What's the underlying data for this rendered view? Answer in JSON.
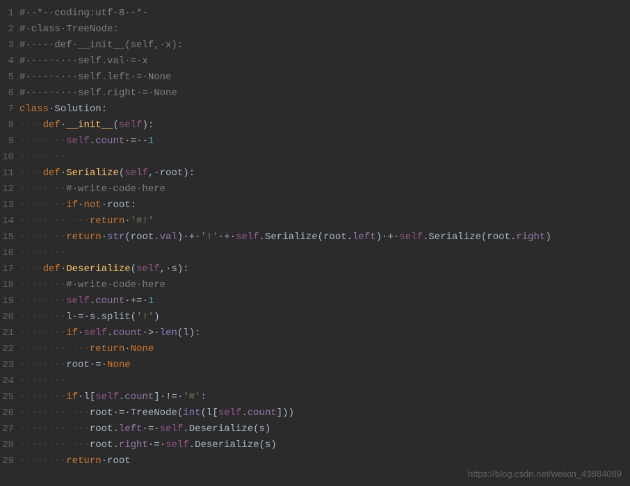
{
  "lines": [
    {
      "n": "1",
      "tokens": [
        [
          "comment",
          "#·-*-·coding:utf-8·-*-"
        ]
      ]
    },
    {
      "n": "2",
      "tokens": [
        [
          "comment",
          "#·class·TreeNode:"
        ]
      ]
    },
    {
      "n": "3",
      "tokens": [
        [
          "comment",
          "#·····def·__init__(self,·x):"
        ]
      ]
    },
    {
      "n": "4",
      "tokens": [
        [
          "comment",
          "#·········self.val·=·x"
        ]
      ]
    },
    {
      "n": "5",
      "tokens": [
        [
          "comment",
          "#·········self.left·=·None"
        ]
      ]
    },
    {
      "n": "6",
      "tokens": [
        [
          "comment",
          "#·········self.right·=·None"
        ]
      ]
    },
    {
      "n": "7",
      "tokens": [
        [
          "keyword",
          "class"
        ],
        [
          "default",
          "·"
        ],
        [
          "classname",
          "Solution"
        ],
        [
          "op",
          ":"
        ]
      ]
    },
    {
      "n": "8",
      "tokens": [
        [
          "dots",
          "····"
        ],
        [
          "keyword",
          "def"
        ],
        [
          "default",
          "·"
        ],
        [
          "funcname",
          "__init__"
        ],
        [
          "op",
          "("
        ],
        [
          "selfp",
          "self"
        ],
        [
          "op",
          ")"
        ],
        [
          "op",
          ":"
        ]
      ]
    },
    {
      "n": "9",
      "tokens": [
        [
          "dots",
          "········"
        ],
        [
          "selfp",
          "self"
        ],
        [
          "op",
          "."
        ],
        [
          "prop",
          "count"
        ],
        [
          "default",
          "·"
        ],
        [
          "op",
          "="
        ],
        [
          "default",
          "·"
        ],
        [
          "op",
          "-"
        ],
        [
          "number",
          "1"
        ]
      ]
    },
    {
      "n": "10",
      "tokens": [
        [
          "dots",
          "········"
        ]
      ]
    },
    {
      "n": "11",
      "tokens": [
        [
          "dots",
          "····"
        ],
        [
          "keyword",
          "def"
        ],
        [
          "default",
          "·"
        ],
        [
          "funcname",
          "Serialize"
        ],
        [
          "op",
          "("
        ],
        [
          "selfp",
          "self"
        ],
        [
          "op",
          ","
        ],
        [
          "default",
          "·"
        ],
        [
          "param",
          "root"
        ],
        [
          "op",
          ")"
        ],
        [
          "op",
          ":"
        ]
      ]
    },
    {
      "n": "12",
      "tokens": [
        [
          "dots",
          "········"
        ],
        [
          "comment",
          "#·write·code·here"
        ]
      ]
    },
    {
      "n": "13",
      "tokens": [
        [
          "dots",
          "········"
        ],
        [
          "keyword",
          "if"
        ],
        [
          "default",
          "·"
        ],
        [
          "keyword",
          "not"
        ],
        [
          "default",
          "·"
        ],
        [
          "default",
          "root"
        ],
        [
          "op",
          ":"
        ]
      ]
    },
    {
      "n": "14",
      "tokens": [
        [
          "dots",
          "············"
        ],
        [
          "keyword",
          "return"
        ],
        [
          "default",
          "·"
        ],
        [
          "string",
          "'#!'"
        ]
      ]
    },
    {
      "n": "15",
      "tokens": [
        [
          "dots",
          "········"
        ],
        [
          "keyword",
          "return"
        ],
        [
          "default",
          "·"
        ],
        [
          "builtin",
          "str"
        ],
        [
          "op",
          "("
        ],
        [
          "default",
          "root"
        ],
        [
          "op",
          "."
        ],
        [
          "prop",
          "val"
        ],
        [
          "op",
          ")"
        ],
        [
          "default",
          "·"
        ],
        [
          "op",
          "+"
        ],
        [
          "default",
          "·"
        ],
        [
          "string",
          "'!'"
        ],
        [
          "default",
          "·"
        ],
        [
          "op",
          "+"
        ],
        [
          "default",
          "·"
        ],
        [
          "selfp",
          "self"
        ],
        [
          "op",
          "."
        ],
        [
          "default",
          "Serialize"
        ],
        [
          "op",
          "("
        ],
        [
          "default",
          "root"
        ],
        [
          "op",
          "."
        ],
        [
          "prop",
          "left"
        ],
        [
          "op",
          ")"
        ],
        [
          "default",
          "·"
        ],
        [
          "op",
          "+"
        ],
        [
          "default",
          "·"
        ],
        [
          "selfp",
          "self"
        ],
        [
          "op",
          "."
        ],
        [
          "default",
          "Serialize"
        ],
        [
          "op",
          "("
        ],
        [
          "default",
          "root"
        ],
        [
          "op",
          "."
        ],
        [
          "prop",
          "right"
        ],
        [
          "op",
          ")"
        ]
      ]
    },
    {
      "n": "16",
      "tokens": [
        [
          "dots",
          "········"
        ]
      ]
    },
    {
      "n": "17",
      "tokens": [
        [
          "dots",
          "····"
        ],
        [
          "keyword",
          "def"
        ],
        [
          "default",
          "·"
        ],
        [
          "funcname",
          "Deserialize"
        ],
        [
          "op",
          "("
        ],
        [
          "selfp",
          "self"
        ],
        [
          "op",
          ","
        ],
        [
          "default",
          "·"
        ],
        [
          "param",
          "s"
        ],
        [
          "op",
          ")"
        ],
        [
          "op",
          ":"
        ]
      ]
    },
    {
      "n": "18",
      "tokens": [
        [
          "dots",
          "········"
        ],
        [
          "comment",
          "#·write·code·here"
        ]
      ]
    },
    {
      "n": "19",
      "tokens": [
        [
          "dots",
          "········"
        ],
        [
          "selfp",
          "self"
        ],
        [
          "op",
          "."
        ],
        [
          "prop",
          "count"
        ],
        [
          "default",
          "·"
        ],
        [
          "op",
          "+="
        ],
        [
          "default",
          "·"
        ],
        [
          "number",
          "1"
        ]
      ]
    },
    {
      "n": "20",
      "tokens": [
        [
          "dots",
          "········"
        ],
        [
          "default",
          "l"
        ],
        [
          "default",
          "·"
        ],
        [
          "op",
          "="
        ],
        [
          "default",
          "·"
        ],
        [
          "default",
          "s"
        ],
        [
          "op",
          "."
        ],
        [
          "default",
          "split"
        ],
        [
          "op",
          "("
        ],
        [
          "string",
          "'!'"
        ],
        [
          "op",
          ")"
        ]
      ]
    },
    {
      "n": "21",
      "tokens": [
        [
          "dots",
          "········"
        ],
        [
          "keyword",
          "if"
        ],
        [
          "default",
          "·"
        ],
        [
          "selfp",
          "self"
        ],
        [
          "op",
          "."
        ],
        [
          "prop",
          "count"
        ],
        [
          "default",
          "·"
        ],
        [
          "op",
          ">"
        ],
        [
          "default",
          "·"
        ],
        [
          "builtin",
          "len"
        ],
        [
          "op",
          "("
        ],
        [
          "default",
          "l"
        ],
        [
          "op",
          ")"
        ],
        [
          "op",
          ":"
        ]
      ]
    },
    {
      "n": "22",
      "tokens": [
        [
          "dots",
          "············"
        ],
        [
          "keyword",
          "return"
        ],
        [
          "default",
          "·"
        ],
        [
          "kwval",
          "None"
        ]
      ]
    },
    {
      "n": "23",
      "tokens": [
        [
          "dots",
          "········"
        ],
        [
          "default",
          "root"
        ],
        [
          "default",
          "·"
        ],
        [
          "op",
          "="
        ],
        [
          "default",
          "·"
        ],
        [
          "kwval",
          "None"
        ]
      ]
    },
    {
      "n": "24",
      "tokens": [
        [
          "dots",
          "········"
        ]
      ]
    },
    {
      "n": "25",
      "tokens": [
        [
          "dots",
          "········"
        ],
        [
          "keyword",
          "if"
        ],
        [
          "default",
          "·"
        ],
        [
          "default",
          "l"
        ],
        [
          "op",
          "["
        ],
        [
          "selfp",
          "self"
        ],
        [
          "op",
          "."
        ],
        [
          "prop",
          "count"
        ],
        [
          "op",
          "]"
        ],
        [
          "default",
          "·"
        ],
        [
          "op",
          "!="
        ],
        [
          "default",
          "·"
        ],
        [
          "string",
          "'#'"
        ],
        [
          "op",
          ":"
        ]
      ]
    },
    {
      "n": "26",
      "tokens": [
        [
          "dots",
          "············"
        ],
        [
          "default",
          "root"
        ],
        [
          "default",
          "·"
        ],
        [
          "op",
          "="
        ],
        [
          "default",
          "·"
        ],
        [
          "default",
          "TreeNode"
        ],
        [
          "op",
          "("
        ],
        [
          "builtin",
          "int"
        ],
        [
          "op",
          "("
        ],
        [
          "default",
          "l"
        ],
        [
          "op",
          "["
        ],
        [
          "selfp",
          "self"
        ],
        [
          "op",
          "."
        ],
        [
          "prop",
          "count"
        ],
        [
          "op",
          "]"
        ],
        [
          "op",
          ")"
        ],
        [
          "op",
          ")"
        ]
      ]
    },
    {
      "n": "27",
      "tokens": [
        [
          "dots",
          "············"
        ],
        [
          "default",
          "root"
        ],
        [
          "op",
          "."
        ],
        [
          "prop",
          "left"
        ],
        [
          "default",
          "·"
        ],
        [
          "op",
          "="
        ],
        [
          "default",
          "·"
        ],
        [
          "selfp",
          "self"
        ],
        [
          "op",
          "."
        ],
        [
          "default",
          "Deserialize"
        ],
        [
          "op",
          "("
        ],
        [
          "default",
          "s"
        ],
        [
          "op",
          ")"
        ]
      ]
    },
    {
      "n": "28",
      "tokens": [
        [
          "dots",
          "············"
        ],
        [
          "default",
          "root"
        ],
        [
          "op",
          "."
        ],
        [
          "prop",
          "right"
        ],
        [
          "default",
          "·"
        ],
        [
          "op",
          "="
        ],
        [
          "default",
          "·"
        ],
        [
          "selfp",
          "self"
        ],
        [
          "op",
          "."
        ],
        [
          "default",
          "Deserialize"
        ],
        [
          "op",
          "("
        ],
        [
          "default",
          "s"
        ],
        [
          "op",
          ")"
        ]
      ]
    },
    {
      "n": "29",
      "tokens": [
        [
          "dots",
          "········"
        ],
        [
          "keyword",
          "return"
        ],
        [
          "default",
          "·"
        ],
        [
          "default",
          "root"
        ]
      ]
    }
  ],
  "watermark": "https://blog.csdn.net/weixin_43884089"
}
